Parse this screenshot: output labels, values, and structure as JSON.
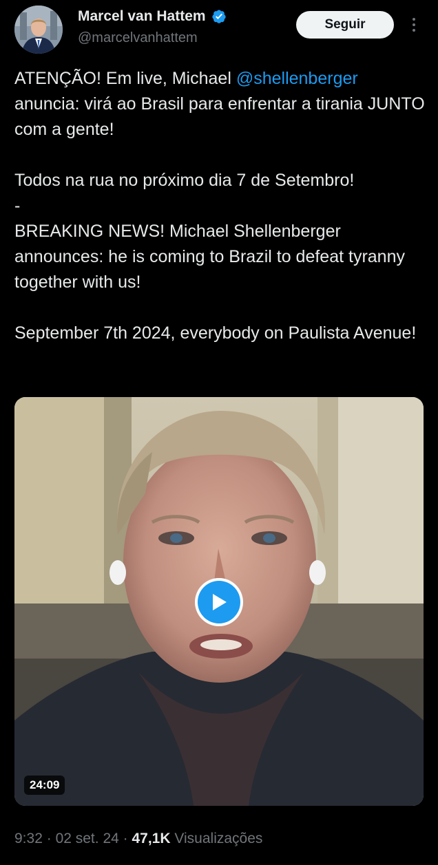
{
  "post": {
    "author": {
      "display_name": "Marcel van Hattem",
      "handle": "@marcelvanhattem",
      "verified_icon": "verified-badge-icon",
      "verified_color": "#1d9bf0"
    },
    "follow_label": "Seguir",
    "more_icon": "more-vertical-icon",
    "text": {
      "line1_before": "ATENÇÃO! Em live, Michael ",
      "mention": "@shellenberger",
      "line1_after": " anuncia: virá ao Brasil para enfrentar a tirania JUNTO com a gente!",
      "para2": "Todos na rua no próximo dia 7 de Setembro!",
      "separator": "-",
      "para3": "BREAKING NEWS! Michael Shellenberger announces: he is coming to Brazil to defeat tyranny together with us!",
      "para4": "September 7th 2024, everybody on Paulista Avenue!"
    },
    "media": {
      "type": "video",
      "duration": "24:09",
      "play_icon": "play-icon"
    },
    "meta": {
      "time": "9:32",
      "date": "02 set. 24",
      "views_count": "47,1K",
      "views_label": "Visualizações",
      "separator": "·"
    }
  },
  "colors": {
    "background": "#000000",
    "text_primary": "#e7e9ea",
    "text_secondary": "#71767b",
    "link": "#1d9bf0",
    "button_bg": "#eff3f4"
  }
}
